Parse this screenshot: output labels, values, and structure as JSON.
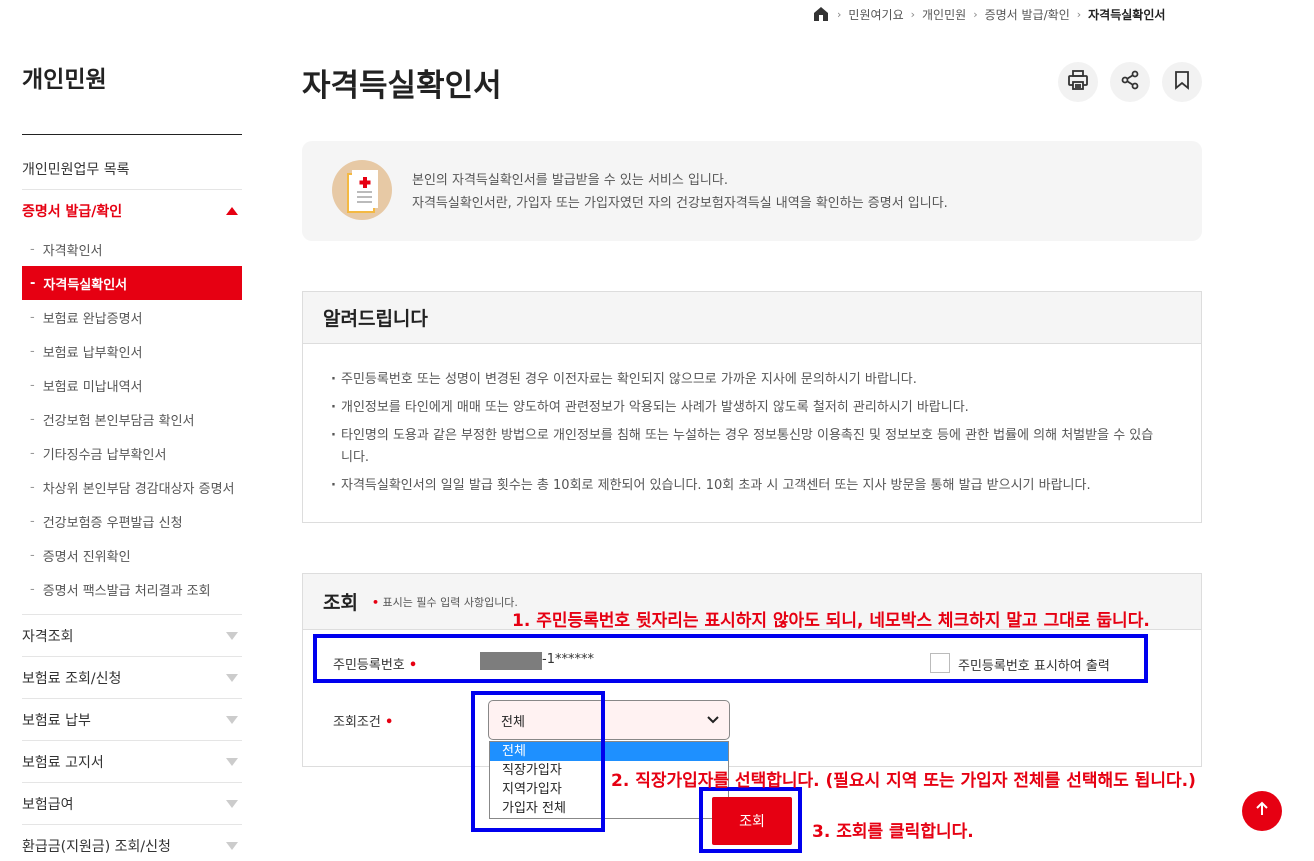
{
  "breadcrumb": [
    "민원여기요",
    "개인민원",
    "증명서 발급/확인",
    "자격득실확인서"
  ],
  "sidebar": {
    "title": "개인민원",
    "top_item": "개인민원업무 목록",
    "open_item": "증명서 발급/확인",
    "sub_items": [
      "자격확인서",
      "자격득실확인서",
      "보험료 완납증명서",
      "보험료 납부확인서",
      "보험료 미납내역서",
      "건강보험 본인부담금 확인서",
      "기타징수금 납부확인서",
      "차상위 본인부담 경감대상자 증명서",
      "건강보험증 우편발급 신청",
      "증명서 진위확인",
      "증명서 팩스발급 처리결과 조회"
    ],
    "active_sub": "자격득실확인서",
    "other_items": [
      "자격조회",
      "보험료 조회/신청",
      "보험료 납부",
      "보험료 고지서",
      "보험급여",
      "환급금(지원금) 조회/신청"
    ]
  },
  "page": {
    "title": "자격득실확인서"
  },
  "info": {
    "line1": "본인의 자격득실확인서를 발급받을 수 있는 서비스 입니다.",
    "line2": "자격득실확인서란, 가입자 또는 가입자였던 자의 건강보험자격득실 내역을 확인하는 증명서 입니다."
  },
  "notice": {
    "title": "알려드립니다",
    "items": [
      "주민등록번호 또는 성명이 변경된 경우 이전자료는 확인되지 않으므로 가까운 지사에 문의하시기 바랍니다.",
      "개인정보를 타인에게 매매 또는 양도하여 관련정보가 악용되는 사례가 발생하지 않도록 철저히 관리하시기 바랍니다.",
      "타인명의 도용과 같은 부정한 방법으로 개인정보를 침해 또는 누설하는 경우 정보통신망 이용촉진 및 정보보호 등에 관한 법률에 의해 처벌받을 수 있습니다.",
      "자격득실확인서의 일일 발급 횟수는 총 10회로 제한되어 있습니다. 10회 초과 시 고객센터 또는 지사 방문을 통해 발급 받으시기 바랍니다."
    ]
  },
  "lookup": {
    "title": "조회",
    "required_dot": "•",
    "required_note": "표시는 필수 입력 사항입니다.",
    "ssn_label": "주민등록번호",
    "ssn_visible": "-1******",
    "show_ssn_label": "주민등록번호 표시하여 출력",
    "condition_label": "조회조건",
    "selected_option": "전체",
    "options": [
      "전체",
      "직장가입자",
      "지역가입자",
      "가입자 전체"
    ],
    "search_button": "조회"
  },
  "annotations": {
    "step1": "1. 주민등록번호 뒷자리는 표시하지 않아도 되니, 네모박스 체크하지 말고 그대로 둡니다.",
    "step2": "2. 직장가입자를 선택합니다. (필요시 지역 또는 가입자 전체를 선택해도 됩니다.)",
    "step3": "3. 조회를 클릭합니다."
  },
  "colors": {
    "accent": "#e60012",
    "annotation_box": "#0000ee",
    "annotation_text": "#e60012"
  },
  "icons": [
    "home-icon",
    "print-icon",
    "share-icon",
    "bookmark-icon",
    "document-icon",
    "arrow-up-icon",
    "chevron-down-icon"
  ]
}
